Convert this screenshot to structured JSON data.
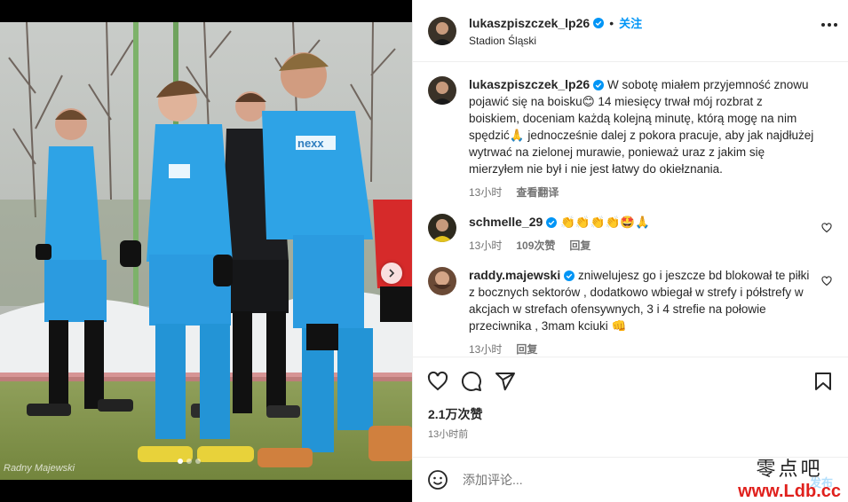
{
  "post": {
    "author": "lukaszpiszczek_lp26",
    "separator": "•",
    "follow_label": "关注",
    "location": "Stadion Śląski"
  },
  "caption": {
    "username": "lukaszpiszczek_lp26",
    "text": "W sobotę miałem przyjemność znowu pojawić się na boisku😊 14 miesięcy trwał mój rozbrat z boiskiem, doceniam każdą kolejną minutę, którą mogę na nim spędzić🙏 jednocześnie dalej z pokora pracuje, aby jak najdłużej wytrwać na zielonej murawie, ponieważ uraz z jakim się mierzyłem nie był i nie jest łatwy do okiełznania.",
    "time": "13小时",
    "translate": "查看翻译"
  },
  "comments": [
    {
      "username": "schmelle_29",
      "text": "👏👏👏👏🤩🙏",
      "time": "13小时",
      "likes": "109次赞",
      "reply": "回复"
    },
    {
      "username": "raddy.majewski",
      "text": "zniwelujesz go i jeszcze bd blokował te piłki z bocznych sektorów , dodatkowo wbiegał w strefy i półstrefy w akcjach w strefach ofensywnych, 3 i 4 strefie na połowie przeciwnika , 3mam kciuki 👊",
      "time": "13小时",
      "likes": "",
      "reply": "回复"
    }
  ],
  "stats": {
    "likes": "2.1万次赞",
    "time": "13小时前"
  },
  "composer": {
    "placeholder": "添加评论...",
    "post_label": "发布"
  },
  "media": {
    "watermark": "Radny Majewski",
    "jersey_sponsor": "nexx"
  },
  "watermark": {
    "line1": "零点吧",
    "line2": "www.Ldb.cc"
  },
  "icons": [
    "heart-icon",
    "comment-icon",
    "share-icon",
    "bookmark-icon",
    "emoji-icon",
    "verified-icon",
    "more-icon",
    "chevron-right-icon"
  ],
  "colors": {
    "accent": "#0095f6",
    "jersey": "#2ea3e6",
    "text": "#262626",
    "muted": "#737373"
  }
}
